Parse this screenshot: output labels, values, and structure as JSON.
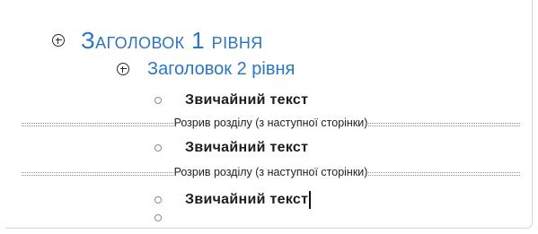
{
  "outline": {
    "heading1": {
      "text": "Заголовок 1 рівня",
      "icon": "expand-plus-icon"
    },
    "heading2": {
      "text": "Заголовок 2 рівня",
      "icon": "expand-plus-icon"
    },
    "body_items": [
      {
        "text": "Звичайний текст",
        "icon": "bullet-circle-icon"
      },
      {
        "text": "Звичайний текст",
        "icon": "bullet-circle-icon"
      },
      {
        "text": "Звичайний текст",
        "icon": "bullet-circle-icon"
      },
      {
        "text": "",
        "icon": "bullet-circle-icon"
      }
    ],
    "section_breaks": [
      {
        "text": "Розрив розділу (з наступної сторінки)"
      },
      {
        "text": "Розрив розділу (з наступної сторінки)"
      }
    ]
  },
  "colors": {
    "heading": "#2a77c0",
    "body_text": "#1c1c1c",
    "break_line": "#8a8a8a"
  }
}
